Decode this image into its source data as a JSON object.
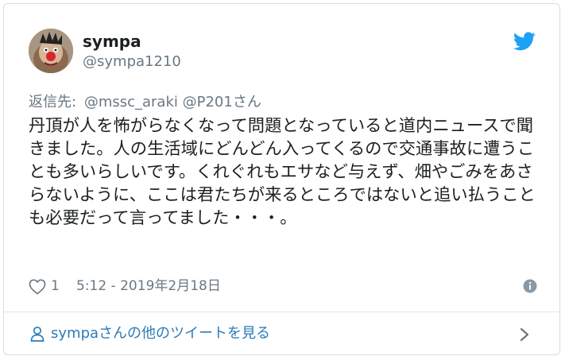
{
  "user": {
    "display_name": "sympa",
    "handle": "@sympa1210",
    "avatar_icon": "clown-avatar"
  },
  "reply": {
    "label": "返信先:",
    "mentions": [
      "@mssc_araki",
      "@P201さん"
    ]
  },
  "tweet": {
    "text": "丹頂が人を怖がらなくなって問題となっていると道内ニュースで聞きました。人の生活域にどんどん入ってくるので交通事故に遭うことも多いらしいです。くれぐれもエサなど与えず、畑やごみをあさらないように、ここは君たちが来るところではないと追い払うことも必要だって言ってました・・・。"
  },
  "meta": {
    "like_count": "1",
    "timestamp": "5:12 - 2019年2月18日"
  },
  "footer": {
    "more_tweets_label": "sympaさんの他のツイートを見る"
  },
  "icons": {
    "brand": "twitter-bird-icon",
    "like": "heart-icon",
    "info": "info-icon",
    "person": "person-icon",
    "chevron": "chevron-right-icon"
  },
  "colors": {
    "twitter_blue": "#1da1f2",
    "link_blue": "#2b7bb9",
    "text": "#1c2022",
    "secondary": "#697882",
    "border": "#e1e8ed"
  }
}
